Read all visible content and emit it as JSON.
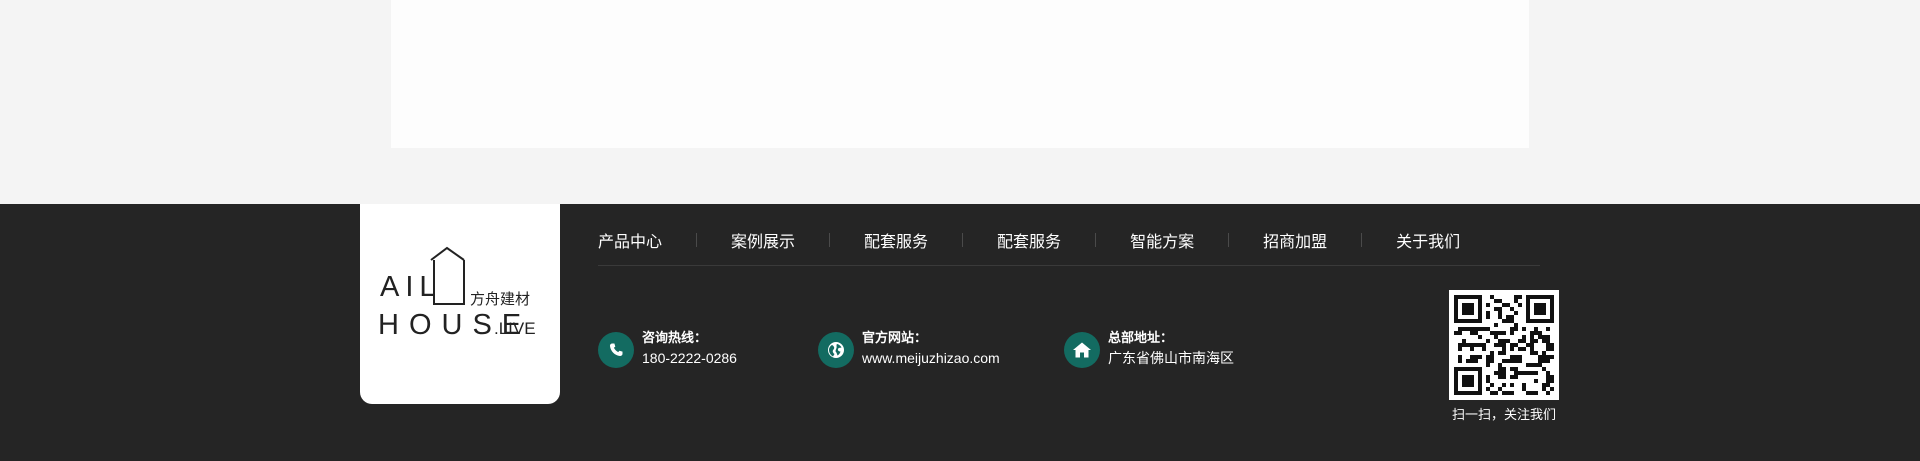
{
  "footer": {
    "logo": {
      "brand_line1": "AIL",
      "brand_line2": "HOUSE",
      "brand_suffix": ".LIVE",
      "brand_cn": "方舟建材"
    },
    "nav": [
      {
        "label": "产品中心"
      },
      {
        "label": "案例展示"
      },
      {
        "label": "配套服务"
      },
      {
        "label": "配套服务"
      },
      {
        "label": "智能方案"
      },
      {
        "label": "招商加盟"
      },
      {
        "label": "关于我们"
      }
    ],
    "contacts": {
      "phone": {
        "label": "咨询热线：",
        "value": "180-2222-0286",
        "icon": "phone-icon"
      },
      "website": {
        "label": "官方网站：",
        "value": "www.meijuzhizao.com",
        "icon": "globe-icon"
      },
      "address": {
        "label": "总部地址：",
        "value": "广东省佛山市南海区",
        "icon": "home-icon"
      }
    },
    "qr_caption": "扫一扫，关注我们"
  },
  "colors": {
    "footer_bg": "#252525",
    "accent": "#136b61",
    "page_bg": "#f4f4f4"
  }
}
